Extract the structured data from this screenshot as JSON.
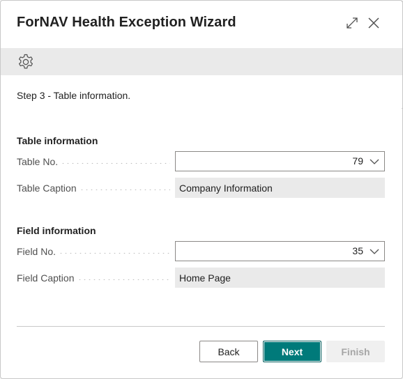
{
  "dialog": {
    "title": "ForNAV Health Exception Wizard",
    "step_text": "Step 3 - Table information."
  },
  "icons": {
    "expand": "expand-diagonal-icon",
    "close": "close-x-icon",
    "settings": "gear-icon",
    "dropdown": "chevron-down-icon"
  },
  "table_group": {
    "title": "Table information",
    "table_no_label": "Table No.",
    "table_no_value": "79",
    "table_caption_label": "Table Caption",
    "table_caption_value": "Company Information"
  },
  "field_group": {
    "title": "Field information",
    "field_no_label": "Field No.",
    "field_no_value": "35",
    "field_caption_label": "Field Caption",
    "field_caption_value": "Home Page"
  },
  "buttons": {
    "back": "Back",
    "next": "Next",
    "finish": "Finish"
  },
  "colors": {
    "accent": "#007a7a",
    "readonly_bg": "#eaeaea",
    "disabled_text": "#a6a6a6"
  }
}
